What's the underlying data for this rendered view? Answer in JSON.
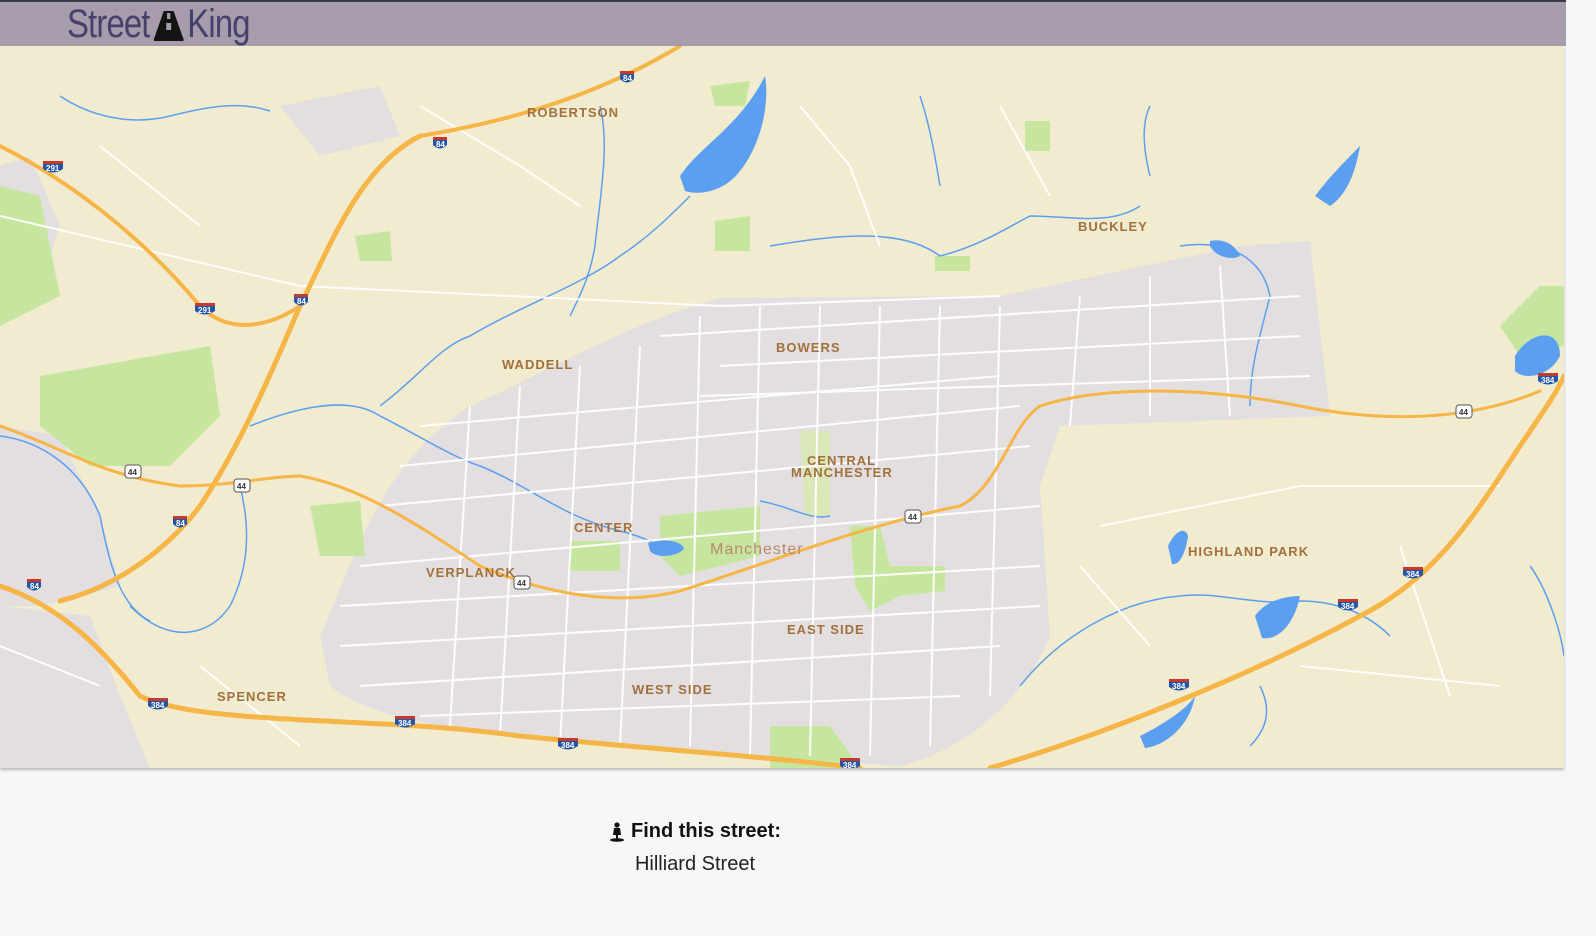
{
  "app": {
    "logo_left": "Street",
    "logo_right": "King",
    "logo_icon": "road-icon"
  },
  "map": {
    "city_label": "Manchester",
    "places": {
      "robertson": "ROBERTSON",
      "buckley": "BUCKLEY",
      "bowers": "BOWERS",
      "waddell": "WADDELL",
      "central1": "CENTRAL",
      "central2": "MANCHESTER",
      "center": "CENTER",
      "verplanck": "VERPLANCK",
      "highland_park": "HIGHLAND PARK",
      "east_side": "EAST SIDE",
      "west_side": "WEST SIDE",
      "spencer": "SPENCER"
    },
    "shields": {
      "i84": "84",
      "i291": "291",
      "i384": "384",
      "us44": "44"
    },
    "colors": {
      "land": "#f1ebcf",
      "urban": "#e3dfe0",
      "park": "#c6e6a0",
      "water": "#5c9ff0",
      "highway": "#f6b547",
      "road": "#ffffff"
    }
  },
  "task": {
    "icon": "person-pin-icon",
    "title": "Find this street:",
    "street": "Hilliard Street"
  }
}
